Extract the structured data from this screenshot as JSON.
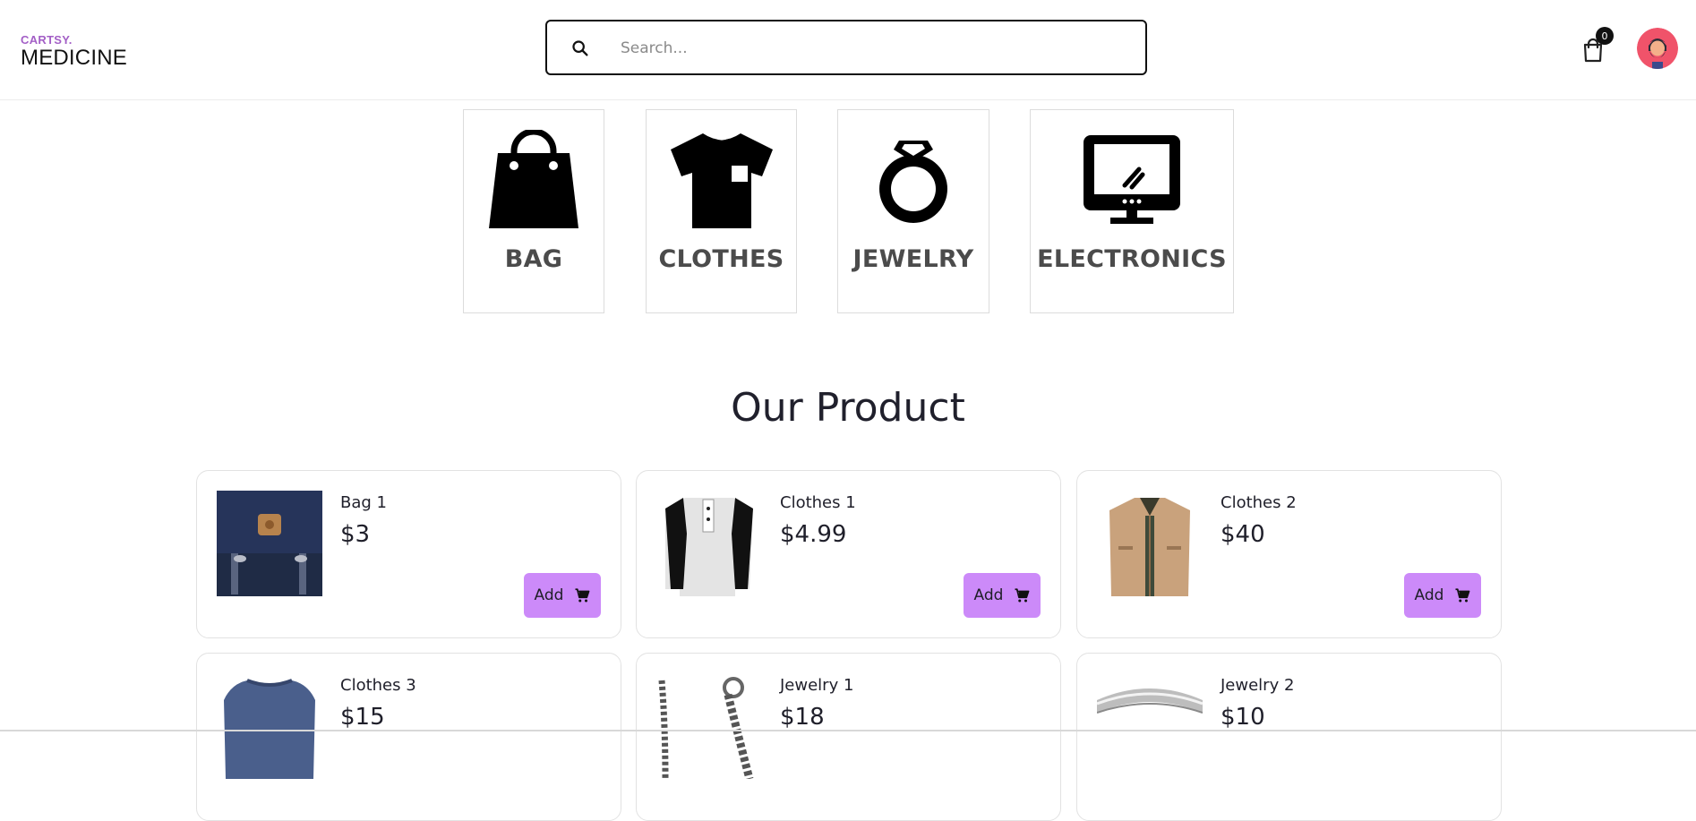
{
  "header": {
    "logo": {
      "top": "CARTSY.",
      "bottom": "MEDICINE"
    },
    "search": {
      "placeholder": "Search...",
      "icon": "search-icon"
    },
    "cart": {
      "icon": "shopping-bag-icon",
      "count": "0"
    },
    "avatar": {
      "icon": "user-avatar"
    }
  },
  "categories": [
    {
      "label": "BAG",
      "icon": "bag-icon"
    },
    {
      "label": "CLOTHES",
      "icon": "tshirt-icon"
    },
    {
      "label": "JEWELRY",
      "icon": "ring-icon"
    },
    {
      "label": "ELECTRONICS",
      "icon": "monitor-icon"
    }
  ],
  "products_section": {
    "title": "Our Product",
    "add_label": "Add",
    "add_icon": "cart-icon",
    "items": [
      {
        "name": "Bag 1",
        "price": "$3"
      },
      {
        "name": "Clothes 1",
        "price": "$4.99"
      },
      {
        "name": "Clothes 2",
        "price": "$40"
      },
      {
        "name": "Clothes 3",
        "price": "$15"
      },
      {
        "name": "Jewelry 1",
        "price": "$18"
      },
      {
        "name": "Jewelry 2",
        "price": "$10"
      }
    ]
  },
  "colors": {
    "accent": "#cc8af9",
    "logo_top": "#a35fc6",
    "category_text": "#4b4b4b"
  }
}
